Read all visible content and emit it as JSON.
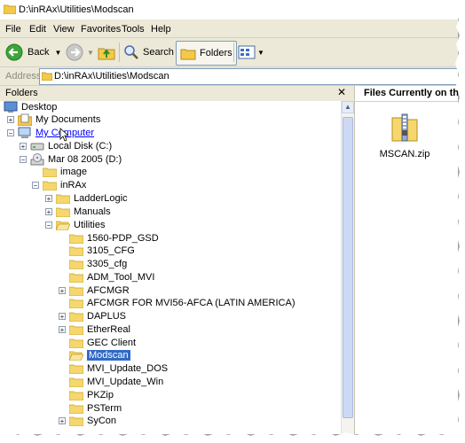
{
  "window": {
    "title": "D:\\inRAx\\Utilities\\Modscan"
  },
  "menu": [
    "File",
    "Edit",
    "View",
    "Favorites",
    "Tools",
    "Help"
  ],
  "toolbar": {
    "back_label": "Back",
    "search_label": "Search",
    "folders_label": "Folders"
  },
  "address": {
    "label": "Address",
    "value": "D:\\inRAx\\Utilities\\Modscan"
  },
  "folders_pane": {
    "title": "Folders",
    "close": "✕"
  },
  "tree": [
    {
      "label": "Desktop"
    },
    {
      "label": "My Documents",
      "exp": "+"
    },
    {
      "label": "My Computer",
      "exp": "−",
      "link": true
    },
    {
      "label": "Local Disk (C:)",
      "exp": "+"
    },
    {
      "label": "Mar 08 2005 (D:)",
      "exp": "−"
    },
    {
      "label": "image"
    },
    {
      "label": "inRAx",
      "exp": "−"
    },
    {
      "label": "LadderLogic",
      "exp": "+"
    },
    {
      "label": "Manuals",
      "exp": "+"
    },
    {
      "label": "Utilities",
      "exp": "−"
    },
    {
      "label": "1560-PDP_GSD"
    },
    {
      "label": "3105_CFG"
    },
    {
      "label": "3305_cfg"
    },
    {
      "label": "ADM_Tool_MVI"
    },
    {
      "label": "AFCMGR",
      "exp": "+"
    },
    {
      "label": "AFCMGR FOR MVI56-AFCA (LATIN AMERICA)"
    },
    {
      "label": "DAPLUS",
      "exp": "+"
    },
    {
      "label": "EtherReal",
      "exp": "+"
    },
    {
      "label": "GEC Client"
    },
    {
      "label": "Modscan",
      "selected": true
    },
    {
      "label": "MVI_Update_DOS"
    },
    {
      "label": "MVI_Update_Win"
    },
    {
      "label": "PKZip"
    },
    {
      "label": "PSTerm"
    },
    {
      "label": "SyCon",
      "exp": "+"
    }
  ],
  "right_pane": {
    "header": "Files Currently on th",
    "file_name": "MSCAN.zip"
  },
  "colors": {
    "selection": "#316ac5",
    "chrome": "#ece9d8",
    "folder": "#f5d76e"
  }
}
